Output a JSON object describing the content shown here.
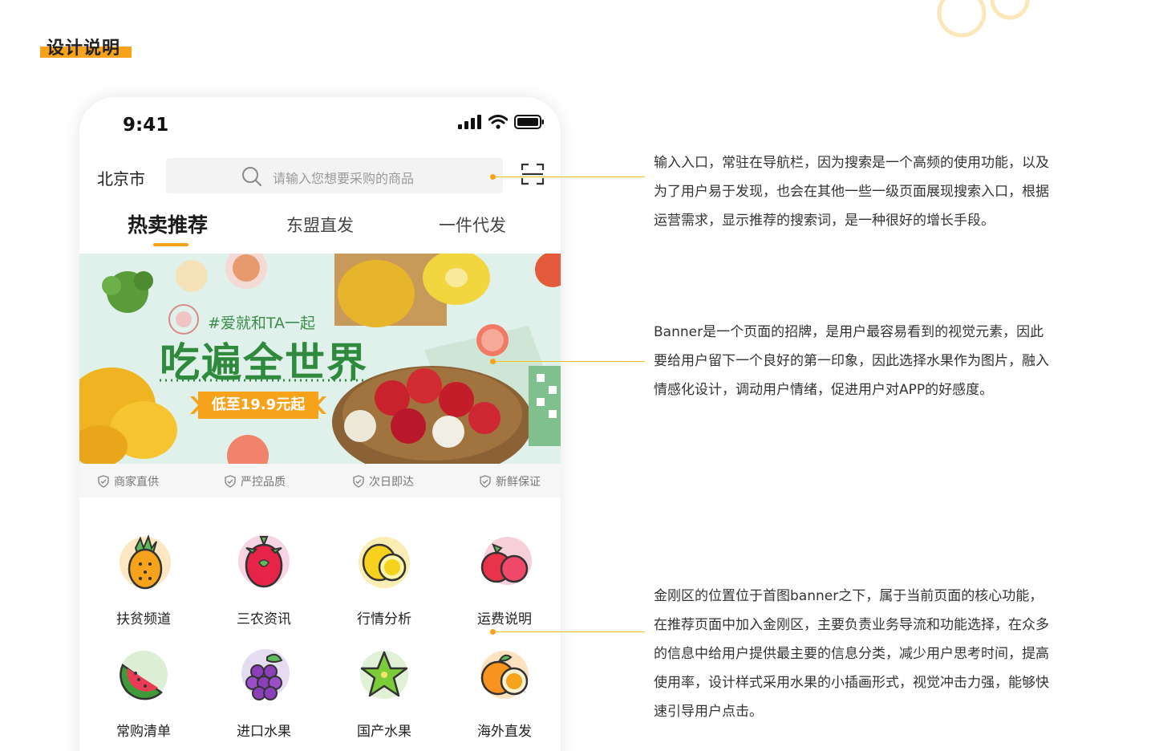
{
  "section_title": "设计说明",
  "colors": {
    "accent": "#f7a21b",
    "connector": "#f7c21b",
    "banner_green": "#2f8a3e"
  },
  "phone": {
    "status_time": "9:41",
    "city": "北京市",
    "search_placeholder": "请输入您想要采购的商品",
    "tabs": [
      {
        "label": "热卖推荐",
        "active": true
      },
      {
        "label": "东盟直发",
        "active": false
      },
      {
        "label": "一件代发",
        "active": false
      }
    ],
    "banner": {
      "tag": "#爱就和TA一起",
      "title": "吃遍全世界",
      "price": "低至19.9元起"
    },
    "guarantees": [
      "商家直供",
      "严控品质",
      "次日即达",
      "新鲜保证"
    ],
    "grid": [
      {
        "label": "扶贫频道",
        "icon": "pineapple-icon"
      },
      {
        "label": "三农资讯",
        "icon": "dragonfruit-icon"
      },
      {
        "label": "行情分析",
        "icon": "lemon-icon"
      },
      {
        "label": "运费说明",
        "icon": "lychee-icon"
      },
      {
        "label": "常购清单",
        "icon": "watermelon-icon"
      },
      {
        "label": "进口水果",
        "icon": "grape-icon"
      },
      {
        "label": "国产水果",
        "icon": "starfruit-icon"
      },
      {
        "label": "海外直发",
        "icon": "orange-icon"
      }
    ]
  },
  "notes": [
    {
      "lines": [
        "输入入口，常驻在导航栏，因为搜索是一个高频的使用功能，以及",
        "为了用户易于发现，也会在其他一些一级页面展现搜索入口，根据",
        "运营需求，显示推荐的搜索词，是一种很好的增长手段。"
      ]
    },
    {
      "lines": [
        "Banner是一个页面的招牌，是用户最容易看到的视觉元素，因此",
        "要给用户留下一个良好的第一印象，因此选择水果作为图片，融入",
        "情感化设计，调动用户情绪，促进用户对APP的好感度。"
      ]
    },
    {
      "lines": [
        "金刚区的位置位于首图banner之下，属于当前页面的核心功能，",
        "在推荐页面中加入金刚区，主要负责业务导流和功能选择，在众多",
        "的信息中给用户提供最主要的信息分类，减少用户思考时间，提高",
        "使用率，设计样式采用水果的小插画形式，视觉冲击力强，能够快",
        "速引导用户点击。"
      ]
    }
  ]
}
